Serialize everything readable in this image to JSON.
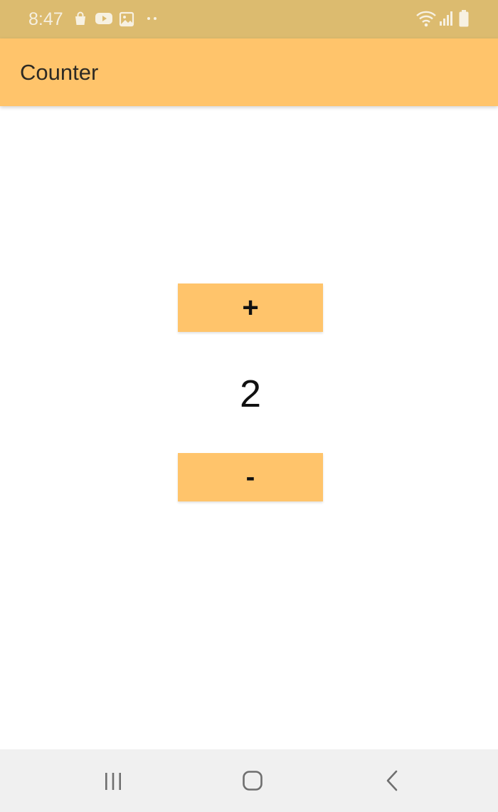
{
  "status_bar": {
    "time": "8:47",
    "left_icons": [
      "shopping-bag-icon",
      "youtube-icon",
      "gallery-icon",
      "more-dots-icon"
    ],
    "right_icons": [
      "wifi-icon",
      "signal-icon",
      "battery-icon"
    ]
  },
  "app_bar": {
    "title": "Counter",
    "color": "#ffc46b"
  },
  "counter": {
    "increment_label": "+",
    "value": "2",
    "decrement_label": "-"
  },
  "nav_bar": {
    "buttons": [
      "recent-apps-icon",
      "home-icon",
      "back-icon"
    ]
  }
}
